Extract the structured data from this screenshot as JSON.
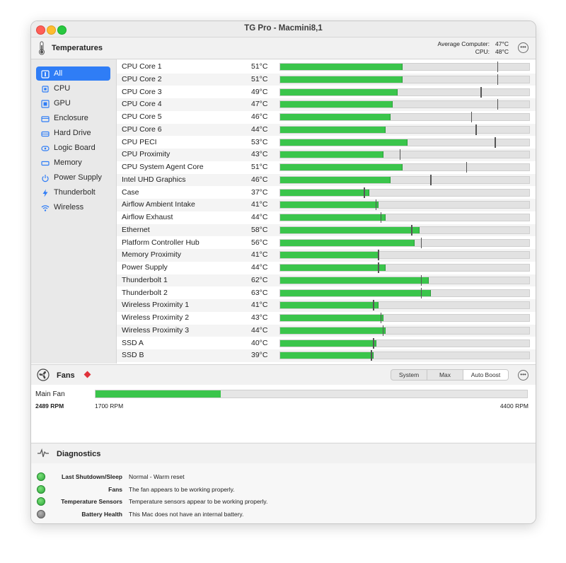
{
  "window": {
    "title": "TG Pro - Macmini8,1"
  },
  "temperatures": {
    "title": "Temperatures",
    "average_label": "Average Computer:",
    "average_value": "47°C",
    "cpu_label": "CPU:",
    "cpu_value": "48°C",
    "more_icon": "ellipsis-circle-icon"
  },
  "sidebar": {
    "items": [
      {
        "label": "All",
        "icon": "all-icon",
        "selected": true
      },
      {
        "label": "CPU",
        "icon": "cpu-icon"
      },
      {
        "label": "GPU",
        "icon": "gpu-icon"
      },
      {
        "label": "Enclosure",
        "icon": "enclosure-icon"
      },
      {
        "label": "Hard Drive",
        "icon": "hard-drive-icon"
      },
      {
        "label": "Logic Board",
        "icon": "logic-board-icon"
      },
      {
        "label": "Memory",
        "icon": "memory-icon"
      },
      {
        "label": "Power Supply",
        "icon": "power-icon"
      },
      {
        "label": "Thunderbolt",
        "icon": "thunderbolt-icon"
      },
      {
        "label": "Wireless",
        "icon": "wireless-icon"
      }
    ]
  },
  "sensors": [
    {
      "name": "CPU Core 1",
      "temp": "51°C",
      "value": 51,
      "max": 91
    },
    {
      "name": "CPU Core 2",
      "temp": "51°C",
      "value": 51,
      "max": 91
    },
    {
      "name": "CPU Core 3",
      "temp": "49°C",
      "value": 49,
      "max": 84
    },
    {
      "name": "CPU Core 4",
      "temp": "47°C",
      "value": 47,
      "max": 91
    },
    {
      "name": "CPU Core 5",
      "temp": "46°C",
      "value": 46,
      "max": 80
    },
    {
      "name": "CPU Core 6",
      "temp": "44°C",
      "value": 44,
      "max": 82
    },
    {
      "name": "CPU PECI",
      "temp": "53°C",
      "value": 53,
      "max": 90
    },
    {
      "name": "CPU Proximity",
      "temp": "43°C",
      "value": 43,
      "max": 50
    },
    {
      "name": "CPU System Agent Core",
      "temp": "51°C",
      "value": 51,
      "max": 78
    },
    {
      "name": "Intel UHD Graphics",
      "temp": "46°C",
      "value": 46,
      "max": 63
    },
    {
      "name": "Case",
      "temp": "37°C",
      "value": 37,
      "max": 35
    },
    {
      "name": "Airflow Ambient Intake",
      "temp": "41°C",
      "value": 41,
      "max": 40
    },
    {
      "name": "Airflow Exhaust",
      "temp": "44°C",
      "value": 44,
      "max": 42
    },
    {
      "name": "Ethernet",
      "temp": "58°C",
      "value": 58,
      "max": 55
    },
    {
      "name": "Platform Controller Hub",
      "temp": "56°C",
      "value": 56,
      "max": 59
    },
    {
      "name": "Memory Proximity",
      "temp": "41°C",
      "value": 41,
      "max": 41
    },
    {
      "name": "Power Supply",
      "temp": "44°C",
      "value": 44,
      "max": 41
    },
    {
      "name": "Thunderbolt 1",
      "temp": "62°C",
      "value": 62,
      "max": 59
    },
    {
      "name": "Thunderbolt 2",
      "temp": "63°C",
      "value": 63,
      "max": 59
    },
    {
      "name": "Wireless Proximity 1",
      "temp": "41°C",
      "value": 41,
      "max": 39
    },
    {
      "name": "Wireless Proximity 2",
      "temp": "43°C",
      "value": 43,
      "max": 42
    },
    {
      "name": "Wireless Proximity 3",
      "temp": "44°C",
      "value": 44,
      "max": 43
    },
    {
      "name": "SSD A",
      "temp": "40°C",
      "value": 40,
      "max": 39
    },
    {
      "name": "SSD B",
      "temp": "39°C",
      "value": 39,
      "max": 38
    }
  ],
  "fans": {
    "title": "Fans",
    "modes": [
      "System",
      "Max",
      "Auto Boost"
    ],
    "active_mode": "Auto Boost",
    "main_fan": {
      "name": "Main Fan",
      "rpm": "2489 RPM",
      "min": "1700 RPM",
      "max": "4400 RPM",
      "fill_fraction": 0.29
    }
  },
  "diagnostics": {
    "title": "Diagnostics",
    "rows": [
      {
        "label": "Last Shutdown/Sleep",
        "value": "Normal - Warm reset",
        "status": "ok"
      },
      {
        "label": "Fans",
        "value": "The fan appears to be working properly.",
        "status": "ok"
      },
      {
        "label": "Temperature Sensors",
        "value": "Temperature sensors appear to be working properly.",
        "status": "ok"
      },
      {
        "label": "Battery Health",
        "value": "This Mac does not have an internal battery.",
        "status": "na"
      }
    ]
  },
  "colors": {
    "accent": "#2f7df6",
    "bar_green": "#3ac54b",
    "warning": "#e0323a"
  }
}
